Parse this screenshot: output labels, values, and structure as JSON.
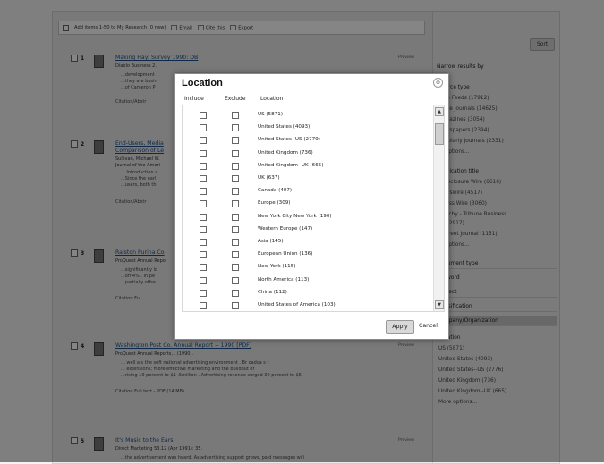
{
  "toolbar": {
    "add_items": "Add items 1-50 to My Research (0 new)",
    "email": "Email",
    "cite": "Cite this",
    "export": "Export"
  },
  "sidebar": {
    "sort": "Sort",
    "narrow": "Narrow results by",
    "source_type": "Source type",
    "source_items": [
      "Wire Feeds (17912)",
      "Trade Journals (14625)",
      "Magazines (3054)",
      "Newspapers (2394)",
      "Scholarly Journals (2331)",
      "re options..."
    ],
    "publication_title": "Publication title",
    "publication_items": [
      "r Disclosure Wire (6616)",
      "Newswire (4517)",
      "siness Wire (3060)",
      "Clatchy - Tribune Business",
      "ws (2917)",
      "ll Street Journal (1151)",
      "re options..."
    ],
    "facets": [
      "Document type",
      "Keyword",
      "Subject",
      "Classification",
      "Company/Organization"
    ],
    "location_head": "Location",
    "location_items": [
      "US (5871)",
      "United States (4093)",
      "United States--US (2776)",
      "United Kingdom (736)",
      "United Kingdom--UK (665)",
      "More options..."
    ]
  },
  "results": [
    {
      "num": "1",
      "title": "Making Hay: Survey 1990: DB",
      "sub": "Diablo Business 2.",
      "snippets": [
        "...development",
        "...they are busin",
        "...of Cameron P"
      ],
      "links": "Citation/Abstr",
      "preview": "Preview"
    },
    {
      "num": "2",
      "title": "End-Users, Media",
      "title2": "Comparison of Le",
      "sub": "Sullivan, Michael W.",
      "sub2": "Journal of the Ameri",
      "snippets": [
        "... Introduction a",
        "...Since the earl",
        "...users, both th"
      ],
      "links": "Citation/Abstr",
      "preview": ""
    },
    {
      "num": "3",
      "title": "Ralston Purina Co",
      "sub": "ProQuest Annual Repo",
      "snippets": [
        "...significantly lo",
        "...off 4% . In pe",
        "...partially offse"
      ],
      "links": "Citation  Ful",
      "preview": ""
    },
    {
      "num": "4",
      "title": "Washington Post Co. Annual Report -- 1990 [PDF]",
      "sub": "ProQuest Annual Reports, . (1990).",
      "snippets": [
        "... well a s the soft national advertising environment . Br oadca s t",
        "... extensions; more effective marketing and the buildout of",
        "...rising 19 percent to $1 .5million . Advertising revenue surged 30 percent to $5"
      ],
      "links": "Citation   Full text - PDF (14 MB)",
      "preview": "Preview"
    },
    {
      "num": "5",
      "title": "It's Music to the Ears",
      "sub": "Direct Marketing 53.12 (Apr 1991): 35.",
      "snippets": [
        "...the advertisement was heard. As advertising support grows, paid messages will"
      ],
      "links": "",
      "preview": "Preview"
    }
  ],
  "modal": {
    "title": "Location",
    "close": "⊗",
    "col_include": "Include",
    "col_exclude": "Exclude",
    "col_location": "Location",
    "options": [
      "US (5871)",
      "United States (4093)",
      "United States--US (2779)",
      "United Kingdom (736)",
      "United Kingdom--UK (665)",
      "UK (637)",
      "Canada (407)",
      "Europe (309)",
      "New York City New York (190)",
      "Western Europe (147)",
      "Asia (145)",
      "European Union (136)",
      "New York (115)",
      "North America (113)",
      "China (112)",
      "United States of America (103)"
    ],
    "apply": "Apply",
    "cancel": "Cancel"
  }
}
